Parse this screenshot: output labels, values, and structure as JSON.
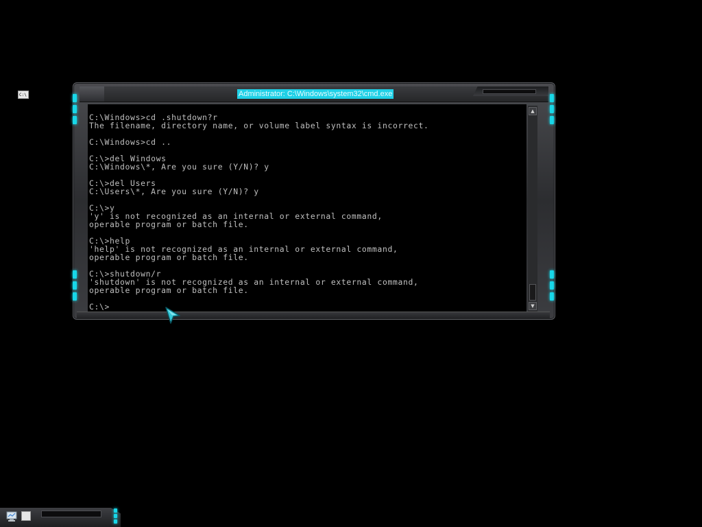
{
  "window": {
    "title": "Administrator: C:\\Windows\\system32\\cmd.exe",
    "icon_label": "C:\\",
    "accent_color": "#1fd0e6"
  },
  "console": {
    "lines": [
      "C:\\Windows>cd .shutdown?r",
      "The filename, directory name, or volume label syntax is incorrect.",
      "",
      "C:\\Windows>cd ..",
      "",
      "C:\\>del Windows",
      "C:\\Windows\\*, Are you sure (Y/N)? y",
      "",
      "C:\\>del Users",
      "C:\\Users\\*, Are you sure (Y/N)? y",
      "",
      "C:\\>y",
      "'y' is not recognized as an internal or external command,",
      "operable program or batch file.",
      "",
      "C:\\>help",
      "'help' is not recognized as an internal or external command,",
      "operable program or batch file.",
      "",
      "C:\\>shutdown/r",
      "'shutdown' is not recognized as an internal or external command,",
      "operable program or batch file.",
      "",
      "C:\\>"
    ]
  },
  "scrollbar": {
    "up_icon": "arrow-up-icon",
    "down_icon": "arrow-down-icon"
  },
  "taskbar": {
    "tray_icon": "network-monitor-icon",
    "task_icon": "window-icon"
  }
}
